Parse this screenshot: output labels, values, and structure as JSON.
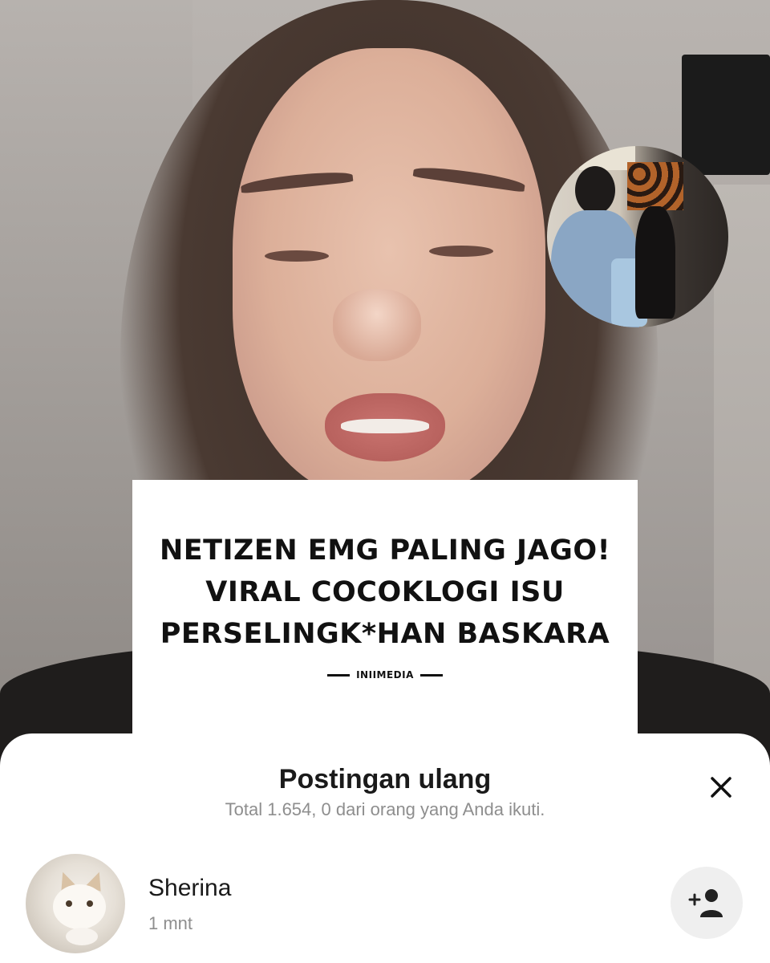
{
  "article": {
    "headline_line1": "NETIZEN EMG PALING JAGO!",
    "headline_line2": "VIRAL COCOKLOGI ISU",
    "headline_line3": "PERSELINGK*HAN BASKARA",
    "brand": "INIIMEDIA"
  },
  "repost_sheet": {
    "title": "Postingan ulang",
    "subtitle": "Total 1.654, 0 dari orang yang Anda ikuti.",
    "close_icon": "close-icon",
    "users": [
      {
        "name": "Sherina",
        "time": "1 mnt",
        "action_icon": "add-person-icon"
      }
    ]
  },
  "colors": {
    "sheet_background": "#ffffff",
    "title_text": "#1a1a1a",
    "muted_text": "#8e8e8e",
    "follow_button_bg": "#efefef"
  }
}
